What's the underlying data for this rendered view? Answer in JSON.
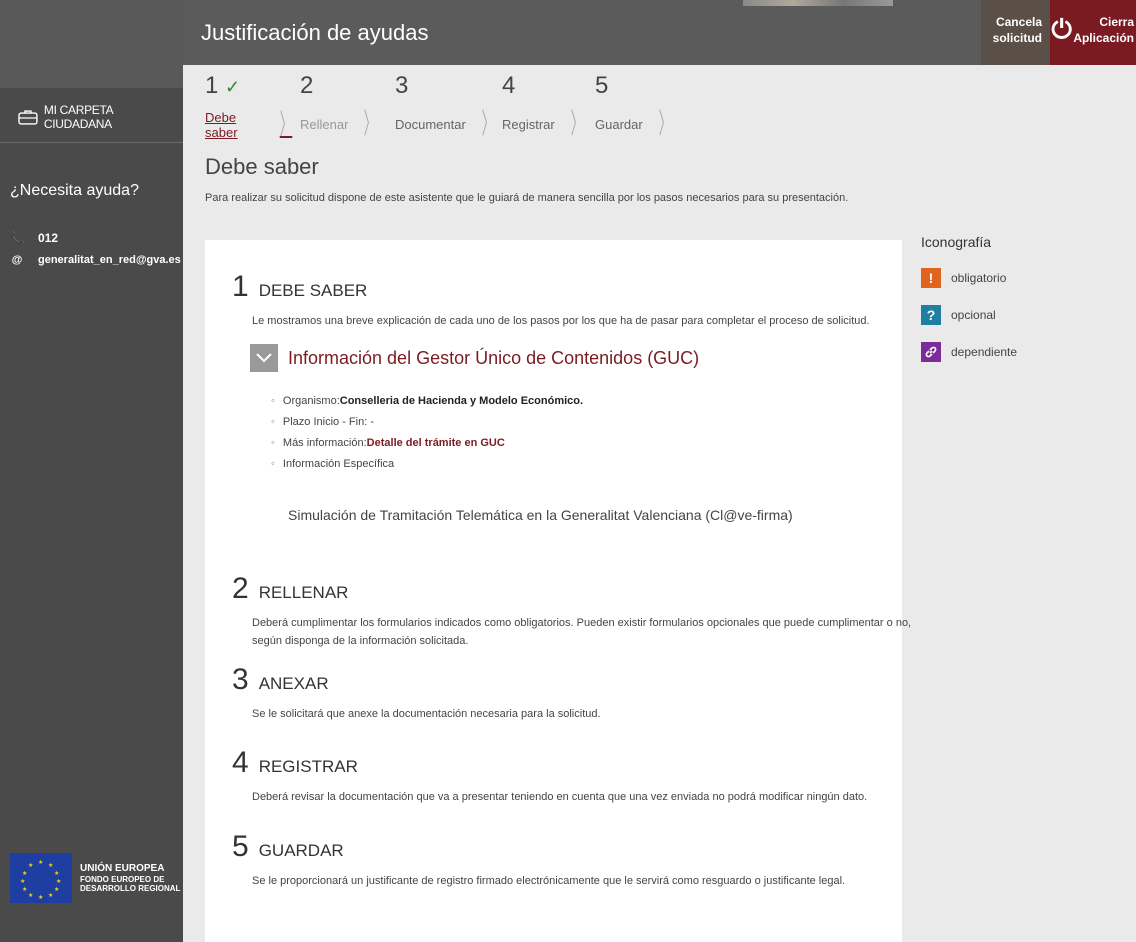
{
  "app": {
    "title": "Justificación de ayudas"
  },
  "header": {
    "cancel_label_1": "Cancela",
    "cancel_label_2": "solicitud",
    "close_label_1": "Cierra",
    "close_label_2": "Aplicación"
  },
  "sidebar": {
    "carpeta": "MI CARPETA CIUDADANA",
    "help_title": "¿Necesita ayuda?",
    "phone": "012",
    "email": "generalitat_en_red@gva.es",
    "eu_title": "UNIÓN EUROPEA",
    "eu_line1": "FONDO EUROPEO DE",
    "eu_line2": "DESARROLLO REGIONAL"
  },
  "steps": [
    {
      "num": "1",
      "label": "Debe saber",
      "done": true
    },
    {
      "num": "2",
      "label": "Rellenar"
    },
    {
      "num": "3",
      "label": "Documentar"
    },
    {
      "num": "4",
      "label": "Registrar"
    },
    {
      "num": "5",
      "label": "Guardar"
    }
  ],
  "page": {
    "heading": "Debe saber",
    "subtitle": "Para realizar su solicitud dispone de este asistente que le guiará de manera sencilla por los pasos necesarios para su presentación."
  },
  "sections": {
    "s1": {
      "num": "1",
      "title": "DEBE SABER",
      "desc": "Le mostramos una breve explicación de cada uno de los pasos por los que ha de pasar para completar el proceso de solicitud."
    },
    "s2": {
      "num": "2",
      "title": "RELLENAR",
      "desc": "Deberá cumplimentar los formularios indicados como obligatorios. Pueden existir formularios opcionales que puede cumplimentar o no, según disponga de la información solicitada."
    },
    "s3": {
      "num": "3",
      "title": "ANEXAR",
      "desc": "Se le solicitará que anexe la documentación necesaria para la solicitud."
    },
    "s4": {
      "num": "4",
      "title": "REGISTRAR",
      "desc": "Deberá revisar la documentación que va a presentar teniendo en cuenta que una vez enviada no podrá modificar ningún dato."
    },
    "s5": {
      "num": "5",
      "title": "GUARDAR",
      "desc": "Se le proporcionará un justificante de registro firmado electrónicamente que le servirá como resguardo o justificante legal."
    }
  },
  "guc": {
    "title": "Información del Gestor Único de Contenidos (GUC)",
    "organismo_label": "Organismo:",
    "organismo_value": "Conselleria de Hacienda y Modelo Económico.",
    "plazo": "Plazo Inicio - Fin: -",
    "mas_info_label": "Más información:",
    "mas_info_link": "Detalle del trámite en GUC",
    "info_especifica": "Información Específica",
    "simulacion": "Simulación de Tramitación Telemática en la Generalitat Valenciana (Cl@ve-firma)"
  },
  "legend": {
    "title": "Iconografía",
    "items": [
      {
        "label": "obligatorio",
        "symbol": "!",
        "color": "#e0631e"
      },
      {
        "label": "opcional",
        "symbol": "?",
        "color": "#1f7fa0"
      },
      {
        "label": "dependiente",
        "symbol": "🔗",
        "color": "#7a2d9a"
      }
    ]
  }
}
